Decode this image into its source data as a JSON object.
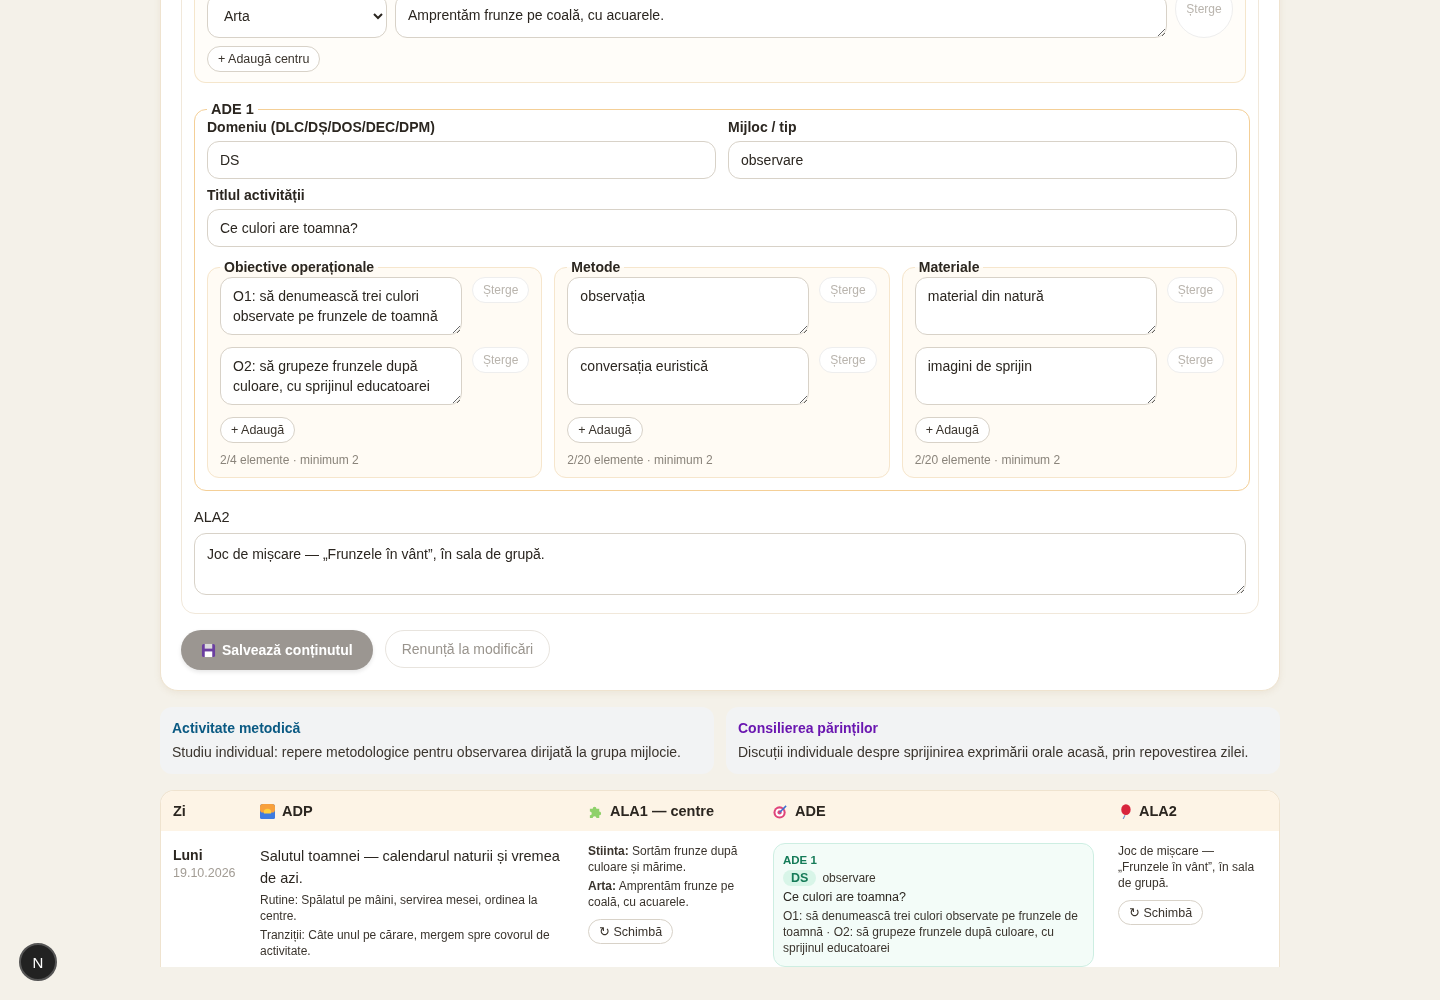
{
  "centers": [
    {
      "area": "Arta",
      "text": "Amprentăm frunze pe coală, cu acuarele.",
      "delete": "Șterge"
    }
  ],
  "add_center": "+ Adaugă centru",
  "ade": {
    "legend": "ADE 1",
    "domain_label": "Domeniu (DLC/DȘ/DOS/DEC/DPM)",
    "domain": "DS",
    "means_label": "Mijloc / tip",
    "means": "observare",
    "title_label": "Titlul activității",
    "title": "Ce culori are toamna?",
    "lists": [
      {
        "legend": "Obiective operaționale",
        "items": [
          {
            "text": "O1: să denumească trei culori observate pe frunzele de toamnă",
            "delete": "Șterge"
          },
          {
            "text": "O2: să grupeze frunzele după culoare, cu sprijinul educatoarei",
            "delete": "Șterge"
          }
        ],
        "add": "+ Adaugă",
        "count": "2/4 elemente · minimum 2"
      },
      {
        "legend": "Metode",
        "items": [
          {
            "text": "observația",
            "delete": "Șterge"
          },
          {
            "text": "conversația euristică",
            "delete": "Șterge"
          }
        ],
        "add": "+ Adaugă",
        "count": "2/20 elemente · minimum 2"
      },
      {
        "legend": "Materiale",
        "items": [
          {
            "text": "material din natură",
            "delete": "Șterge"
          },
          {
            "text": "imagini de sprijin",
            "delete": "Șterge"
          }
        ],
        "add": "+ Adaugă",
        "count": "2/20 elemente · minimum 2"
      }
    ]
  },
  "ala2": {
    "label": "ALA2",
    "value": "Joc de mișcare — „Frunzele în vânt”, în sala de grupă."
  },
  "actions": {
    "save": {
      "label": "Salvează conținutul",
      "disabled": true
    },
    "cancel": "Renunță la modificări"
  },
  "notes": [
    {
      "title": "Activitate metodică",
      "text": "Studiu individual: repere metodologice pentru observarea dirijată la grupa mijlocie.",
      "color": "#0b5a83"
    },
    {
      "title": "Consilierea părinților",
      "text": "Discuții individuale despre sprijinirea exprimării orale acasă, prin repovestirea zilei.",
      "color": "#6a16b0"
    }
  ],
  "table": {
    "columns": [
      {
        "label": "Zi",
        "kind": "plain"
      },
      {
        "label": "ADP",
        "kind": "sunrise"
      },
      {
        "label": "ALA1 — centre",
        "kind": "puzzle"
      },
      {
        "label": "ADE",
        "kind": "target"
      },
      {
        "label": "ALA2",
        "kind": "balloon"
      }
    ],
    "rows": [
      {
        "day": "Luni",
        "date": "19.10.2026",
        "adp": {
          "title": "Salutul toamnei — calendarul naturii și vremea de azi.",
          "lines": [
            "Rutine: Spălatul pe mâini, servirea mesei, ordinea la centre.",
            "Tranziții: Câte unul pe cărare, mergem spre covorul de activitate."
          ]
        },
        "ala1": {
          "centers": [
            "**Stiinta:** Sortăm frunze după culoare și mărime.",
            "**Arta:** Amprentăm frunze pe coală, cu acuarele."
          ],
          "button": "↻ Schimbă"
        },
        "ade": {
          "heading": "ADE 1",
          "domain": "DS",
          "means": "observare",
          "title": "Ce culori are toamna?",
          "objectives": "O1: să denumească trei culori observate pe frunzele de toamnă · O2: să grupeze frunzele după culoare, cu sprijinul educatoarei"
        },
        "ala2": {
          "text": "Joc de mișcare — „Frunzele în vânt”, în sala de grupă.",
          "button": "↻ Schimbă"
        }
      }
    ]
  },
  "avatar": "N"
}
